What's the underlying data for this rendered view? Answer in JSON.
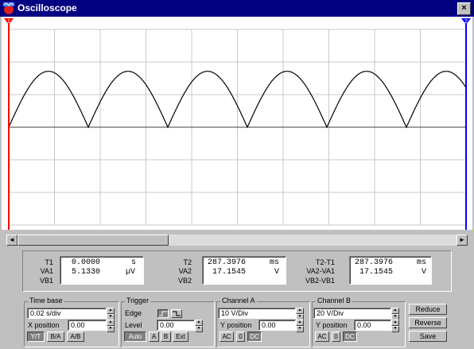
{
  "window": {
    "title": "Oscilloscope",
    "close_label": "×"
  },
  "scroll": {
    "left_arrow": "◄",
    "right_arrow": "►"
  },
  "cursors": {
    "cursor1_label": "1",
    "cursor2_label": "2",
    "cursor1_color": "#ff0000",
    "cursor2_color": "#0000ff"
  },
  "readout": {
    "t1": {
      "label": "T1",
      "value": "0.0000",
      "unit": "s"
    },
    "va1": {
      "label": "VA1",
      "value": "5.1330",
      "unit": "µV"
    },
    "vb1": {
      "label": "VB1",
      "value": "",
      "unit": ""
    },
    "t2": {
      "label": "T2",
      "value": "287.3976",
      "unit": "ms"
    },
    "va2": {
      "label": "VA2",
      "value": "17.1545",
      "unit": "V"
    },
    "vb2": {
      "label": "VB2",
      "value": "",
      "unit": ""
    },
    "dt": {
      "label": "T2-T1",
      "value": "287.3976",
      "unit": "ms"
    },
    "dva": {
      "label": "VA2-VA1",
      "value": "17.1545",
      "unit": "V"
    },
    "dvb": {
      "label": "VB2-VB1",
      "value": "",
      "unit": ""
    }
  },
  "timebase": {
    "title": "Time base",
    "scale": "0.02 s/div",
    "xpos_label": "X position",
    "xpos_value": "0.00",
    "modes": [
      "Y/T",
      "B/A",
      "A/B"
    ],
    "active_mode": "Y/T"
  },
  "trigger": {
    "title": "Trigger",
    "edge_label": "Edge",
    "level_label": "Level",
    "level_value": "0.00",
    "sources": [
      "Auto",
      "A",
      "B",
      "Ext"
    ]
  },
  "channel_a": {
    "title": "Channel A",
    "scale": "10 V/Div",
    "ypos_label": "Y position",
    "ypos_value": "0.00",
    "coupling": [
      "AC",
      "0",
      "DC"
    ],
    "active_coupling": "DC"
  },
  "channel_b": {
    "title": "Channel B",
    "scale": "20 V/Div",
    "ypos_label": "Y position",
    "ypos_value": "0.00",
    "coupling": [
      "AC",
      "0",
      "DC"
    ],
    "active_coupling": "DC"
  },
  "actions": {
    "reduce": "Reduce",
    "reverse": "Reverse",
    "save": "Save"
  },
  "waveform": {
    "type": "full-wave rectified sine",
    "channel": "A",
    "peak_volts": 17.1545,
    "periods_visible": 5.75,
    "cycles_per_10_div": 5.75
  },
  "colors": {
    "titlebar": "#000080",
    "face": "#c0c0c0",
    "trace": "#000000",
    "grid": "#c8c8c8"
  }
}
